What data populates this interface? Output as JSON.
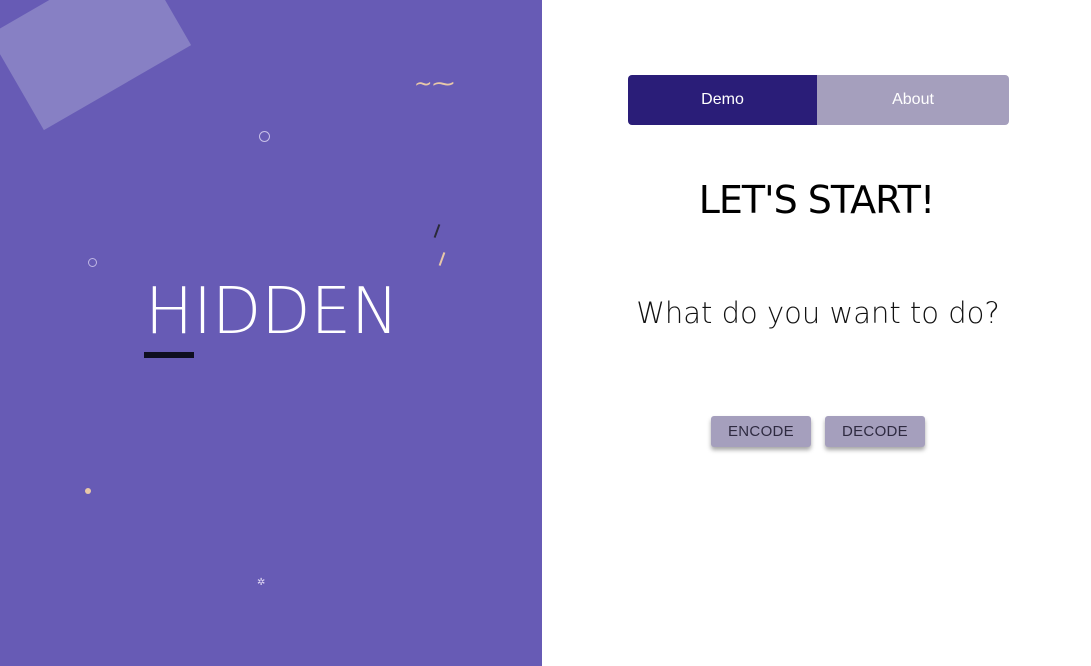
{
  "brand": {
    "name": "HIDDEN",
    "accent_color": "#675bb5"
  },
  "tabs": [
    {
      "label": "Demo",
      "active": true
    },
    {
      "label": "About",
      "active": false
    }
  ],
  "main": {
    "heading": "LET'S START!",
    "question": "What do you want to do?"
  },
  "actions": {
    "encode_label": "ENCODE",
    "decode_label": "DECODE"
  },
  "colors": {
    "tab_active": "#2a1d78",
    "tab_inactive": "#a59fbd",
    "button": "#a59fbd"
  },
  "decorations": {
    "squiggle": "~⁓",
    "star": "✲"
  }
}
